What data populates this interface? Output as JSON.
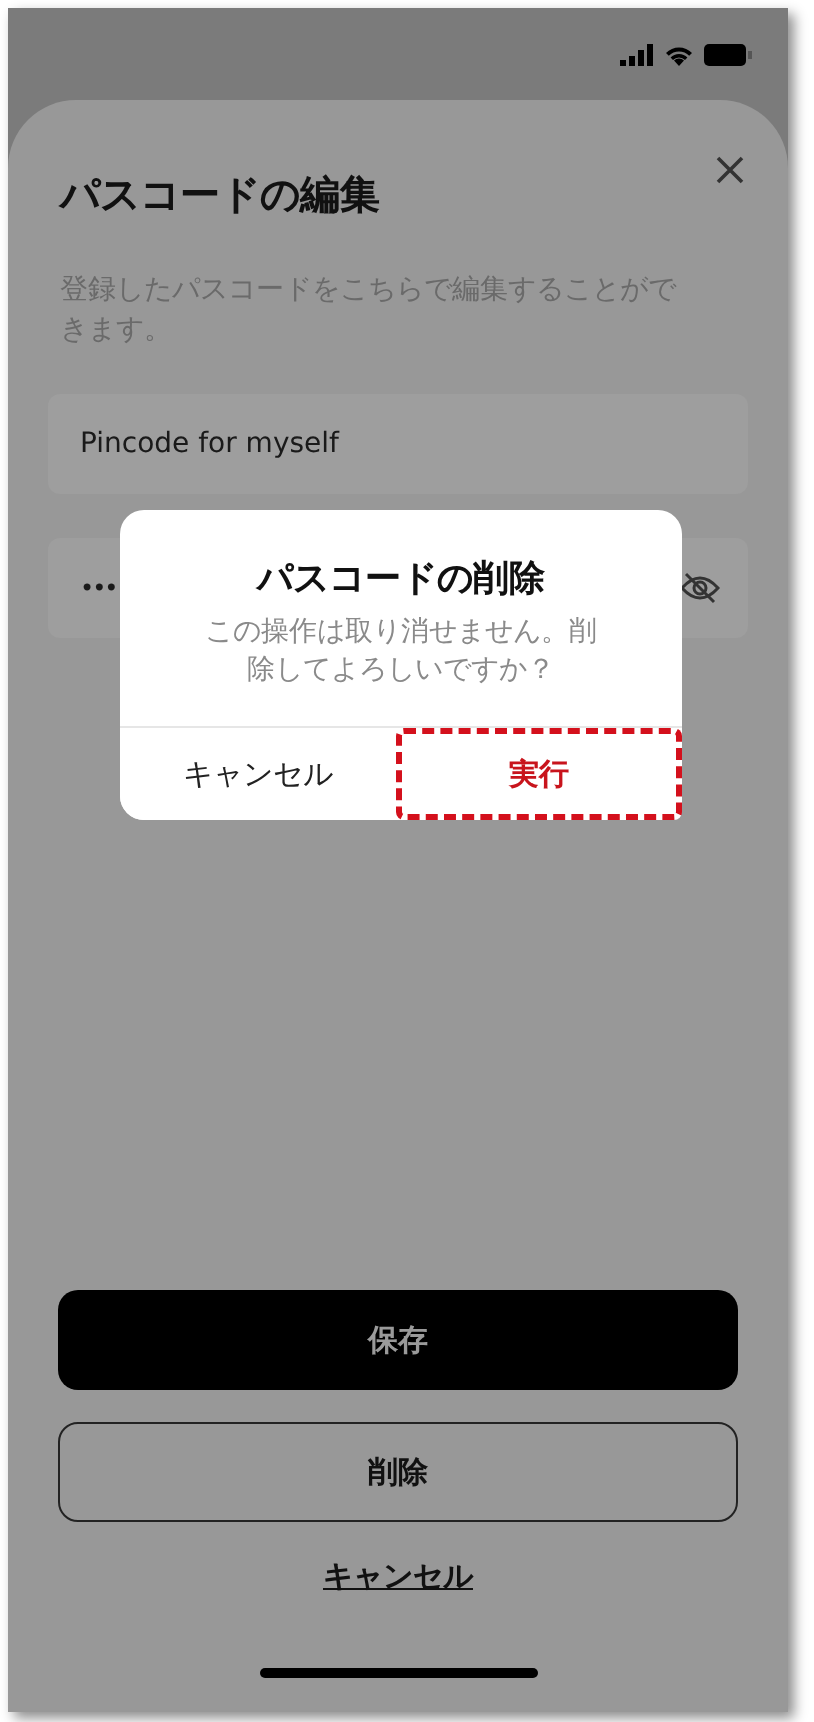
{
  "sheet": {
    "title": "パスコードの編集",
    "description": "登録したパスコードをこちらで編集することができます。",
    "fields": [
      {
        "kind": "text",
        "value": "Pincode for myself"
      },
      {
        "kind": "password",
        "value": "•••"
      }
    ],
    "buttons": [
      {
        "kind": "primary",
        "label": "保存"
      },
      {
        "kind": "outline",
        "label": "削除"
      },
      {
        "kind": "link",
        "label": "キャンセル"
      }
    ]
  },
  "dialog": {
    "title": "パスコードの削除",
    "message": "この操作は取り消せません。削除してよろしいですか？",
    "actions": [
      {
        "label": "キャンセル",
        "destructive": false,
        "highlighted": false
      },
      {
        "label": "実行",
        "destructive": true,
        "highlighted": true
      }
    ]
  }
}
